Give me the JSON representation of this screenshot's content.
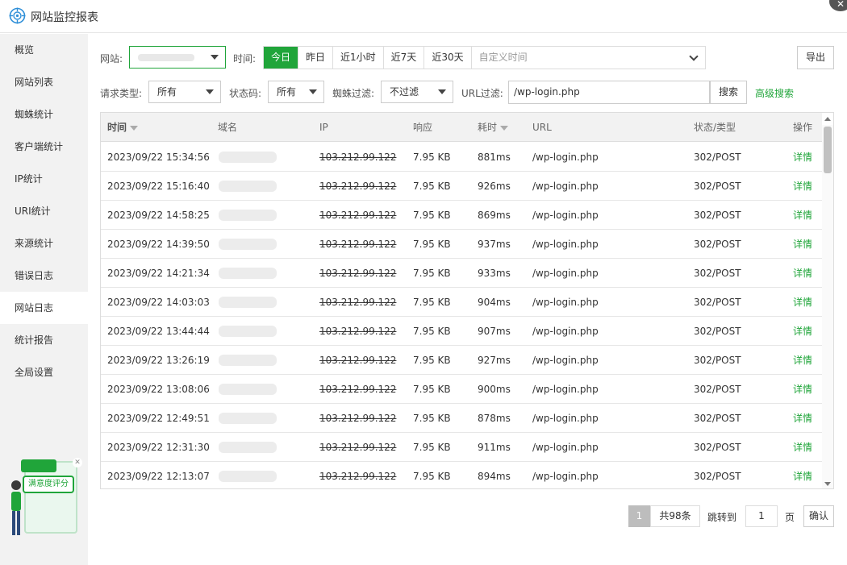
{
  "window": {
    "title": "网站监控报表"
  },
  "sidebar": {
    "items": [
      {
        "label": "概览"
      },
      {
        "label": "网站列表"
      },
      {
        "label": "蜘蛛统计"
      },
      {
        "label": "客户端统计"
      },
      {
        "label": "IP统计"
      },
      {
        "label": "URI统计"
      },
      {
        "label": "来源统计"
      },
      {
        "label": "错误日志"
      },
      {
        "label": "网站日志",
        "active": true
      },
      {
        "label": "统计报告"
      },
      {
        "label": "全局设置"
      }
    ],
    "rating_widget": {
      "label": "满意度评分"
    }
  },
  "filters": {
    "site_label": "网站:",
    "time_label": "时间:",
    "time_options": [
      "今日",
      "昨日",
      "近1小时",
      "近7天",
      "近30天"
    ],
    "time_active": "今日",
    "custom_time_placeholder": "自定义时间",
    "export_label": "导出",
    "request_type_label": "请求类型:",
    "request_type_value": "所有",
    "status_code_label": "状态码:",
    "status_code_value": "所有",
    "spider_filter_label": "蜘蛛过滤:",
    "spider_filter_value": "不过滤",
    "url_filter_label": "URL过滤:",
    "url_filter_value": "/wp-login.php",
    "search_label": "搜索",
    "advanced_search_label": "高级搜索"
  },
  "table": {
    "headers": {
      "time": "时间",
      "domain": "域名",
      "ip": "IP",
      "response": "响应",
      "elapsed": "耗时",
      "url": "URL",
      "status_type": "状态/类型",
      "action": "操作"
    },
    "rows": [
      {
        "time": "2023/09/22 15:34:56",
        "ip": "103.212.99.122",
        "response": "7.95 KB",
        "elapsed": "881ms",
        "url": "/wp-login.php",
        "status": "302/POST",
        "action": "详情"
      },
      {
        "time": "2023/09/22 15:16:40",
        "ip": "103.212.99.122",
        "response": "7.95 KB",
        "elapsed": "926ms",
        "url": "/wp-login.php",
        "status": "302/POST",
        "action": "详情"
      },
      {
        "time": "2023/09/22 14:58:25",
        "ip": "103.212.99.122",
        "response": "7.95 KB",
        "elapsed": "869ms",
        "url": "/wp-login.php",
        "status": "302/POST",
        "action": "详情"
      },
      {
        "time": "2023/09/22 14:39:50",
        "ip": "103.212.99.122",
        "response": "7.95 KB",
        "elapsed": "937ms",
        "url": "/wp-login.php",
        "status": "302/POST",
        "action": "详情"
      },
      {
        "time": "2023/09/22 14:21:34",
        "ip": "103.212.99.122",
        "response": "7.95 KB",
        "elapsed": "933ms",
        "url": "/wp-login.php",
        "status": "302/POST",
        "action": "详情"
      },
      {
        "time": "2023/09/22 14:03:03",
        "ip": "103.212.99.122",
        "response": "7.95 KB",
        "elapsed": "904ms",
        "url": "/wp-login.php",
        "status": "302/POST",
        "action": "详情"
      },
      {
        "time": "2023/09/22 13:44:44",
        "ip": "103.212.99.122",
        "response": "7.95 KB",
        "elapsed": "907ms",
        "url": "/wp-login.php",
        "status": "302/POST",
        "action": "详情"
      },
      {
        "time": "2023/09/22 13:26:19",
        "ip": "103.212.99.122",
        "response": "7.95 KB",
        "elapsed": "927ms",
        "url": "/wp-login.php",
        "status": "302/POST",
        "action": "详情"
      },
      {
        "time": "2023/09/22 13:08:06",
        "ip": "103.212.99.122",
        "response": "7.95 KB",
        "elapsed": "900ms",
        "url": "/wp-login.php",
        "status": "302/POST",
        "action": "详情"
      },
      {
        "time": "2023/09/22 12:49:51",
        "ip": "103.212.99.122",
        "response": "7.95 KB",
        "elapsed": "878ms",
        "url": "/wp-login.php",
        "status": "302/POST",
        "action": "详情"
      },
      {
        "time": "2023/09/22 12:31:30",
        "ip": "103.212.99.122",
        "response": "7.95 KB",
        "elapsed": "911ms",
        "url": "/wp-login.php",
        "status": "302/POST",
        "action": "详情"
      },
      {
        "time": "2023/09/22 12:13:07",
        "ip": "103.212.99.122",
        "response": "7.95 KB",
        "elapsed": "894ms",
        "url": "/wp-login.php",
        "status": "302/POST",
        "action": "详情"
      }
    ]
  },
  "pagination": {
    "current": "1",
    "total": "共98条",
    "jump_label": "跳转到",
    "jump_value": "1",
    "page_label": "页",
    "confirm_label": "确认"
  },
  "colors": {
    "accent": "#20a53a",
    "sidebar_bg": "#f2f2f2",
    "header_bg": "#f2f2f2"
  }
}
